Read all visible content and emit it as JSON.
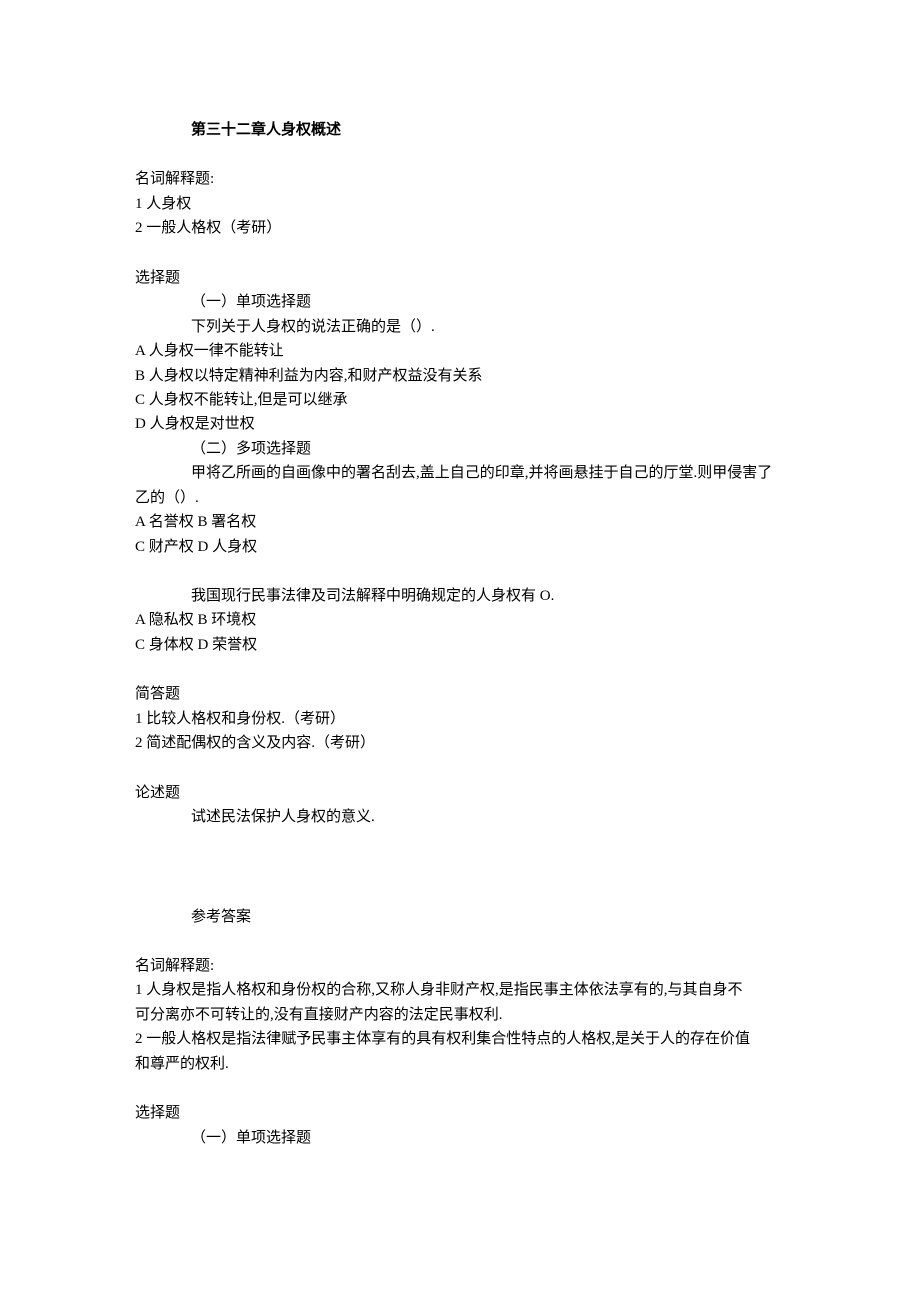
{
  "title": "第三十二章人身权概述",
  "sections": {
    "terms": {
      "heading": "名词解释题:",
      "items": [
        "1 人身权",
        "2 一般人格权（考研）"
      ]
    },
    "choice": {
      "heading": "选择题",
      "single_label": "（一）单项选择题",
      "single_stem": "下列关于人身权的说法正确的是（）.",
      "single_options": [
        "A 人身权一律不能转让",
        "B 人身权以特定精神利益为内容,和财产权益没有关系",
        "C 人身权不能转让,但是可以继承",
        "D 人身权是对世权"
      ],
      "multi_label": "（二）多项选择题",
      "multi_q1_stem": "甲将乙所画的自画像中的署名刮去,盖上自己的印章,并将画悬挂于自己的厅堂.则甲侵害了",
      "multi_q1_stem_tail": "乙的（）.",
      "multi_q1_options": [
        "A 名誉权 B 署名权",
        "C 财产权 D 人身权"
      ],
      "multi_q2_stem": "我国现行民事法律及司法解释中明确规定的人身权有 O.",
      "multi_q2_options": [
        "A 隐私权 B 环境权",
        "C 身体权 D 荣誉权"
      ]
    },
    "short": {
      "heading": "简答题",
      "items": [
        "1 比较人格权和身份权.（考研）",
        "2 简述配偶权的含义及内容.（考研）"
      ]
    },
    "essay": {
      "heading": "论述题",
      "item": "试述民法保护人身权的意义."
    },
    "answers": {
      "heading": "参考答案",
      "terms_heading": "名词解释题:",
      "term1_line1": "1 人身权是指人格权和身份权的合称,又称人身非财产权,是指民事主体依法享有的,与其自身不",
      "term1_line2": "可分离亦不可转让的,没有直接财产内容的法定民事权利.",
      "term2_line1": "2 一般人格权是指法律赋予民事主体享有的具有权利集合性特点的人格权,是关于人的存在价值",
      "term2_line2": "和尊严的权利.",
      "choice_heading": "选择题",
      "single_label": "（一）单项选择题"
    }
  }
}
